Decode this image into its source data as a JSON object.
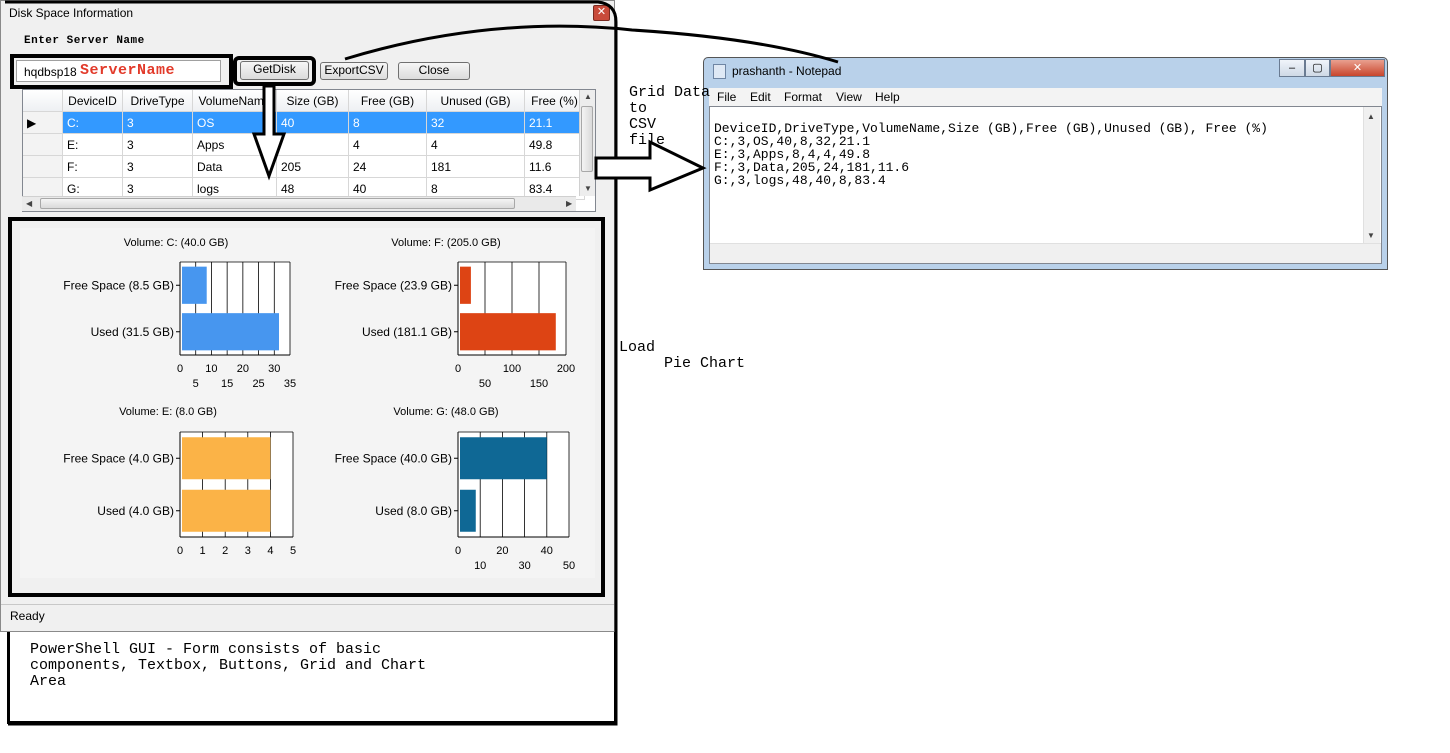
{
  "form": {
    "title": "Disk Space Information",
    "server_label": "Enter Server Name",
    "server_value": "hqdbsp18",
    "server_annotation": "ServerName",
    "buttons": {
      "getdisk": "GetDisk",
      "export": "ExportCSV",
      "close": "Close"
    },
    "status": "Ready"
  },
  "grid": {
    "columns": [
      "DeviceID",
      "DriveType",
      "VolumeName",
      "Size (GB)",
      "Free (GB)",
      "Unused (GB)",
      "Free (%)"
    ],
    "rows": [
      [
        "C:",
        "3",
        "OS",
        "40",
        "8",
        "32",
        "21.1"
      ],
      [
        "E:",
        "3",
        "Apps",
        "",
        "4",
        "4",
        "49.8"
      ],
      [
        "F:",
        "3",
        "Data",
        "205",
        "24",
        "181",
        "11.6"
      ],
      [
        "G:",
        "3",
        "logs",
        "48",
        "40",
        "8",
        "83.4"
      ]
    ],
    "selected_row": 0,
    "row_marker": "▶"
  },
  "chart_data": [
    {
      "type": "bar",
      "orientation": "horizontal",
      "title": "Volume: C: (40.0 GB)",
      "categories": [
        "Free Space (8.5 GB)",
        "Used (31.5 GB)"
      ],
      "values": [
        8.5,
        31.5
      ],
      "xlim": [
        0,
        35
      ],
      "ticks_top": [
        "0",
        "10",
        "20",
        "30"
      ],
      "ticks_bottom": [
        "5",
        "15",
        "25",
        "35"
      ],
      "color": "#4796ef",
      "grid": true
    },
    {
      "type": "bar",
      "orientation": "horizontal",
      "title": "Volume: F: (205.0 GB)",
      "categories": [
        "Free Space (23.9 GB)",
        "Used (181.1 GB)"
      ],
      "values": [
        23.9,
        181.1
      ],
      "xlim": [
        0,
        200
      ],
      "ticks_top": [
        "0",
        "100",
        "200"
      ],
      "ticks_bottom": [
        "50",
        "150"
      ],
      "color": "#dd4414",
      "grid": true
    },
    {
      "type": "bar",
      "orientation": "horizontal",
      "title": "Volume: E: (8.0 GB)",
      "categories": [
        "Free Space (4.0 GB)",
        "Used (4.0 GB)"
      ],
      "values": [
        4.0,
        4.0
      ],
      "xlim": [
        0,
        5
      ],
      "ticks_top": [
        "0",
        "1",
        "2",
        "3",
        "4",
        "5"
      ],
      "ticks_bottom": [],
      "color": "#fbb347",
      "grid": true
    },
    {
      "type": "bar",
      "orientation": "horizontal",
      "title": "Volume: G: (48.0 GB)",
      "categories": [
        "Free Space (40.0 GB)",
        "Used (8.0 GB)"
      ],
      "values": [
        40.0,
        8.0
      ],
      "xlim": [
        0,
        50
      ],
      "ticks_top": [
        "0",
        "20",
        "40"
      ],
      "ticks_bottom": [
        "10",
        "30",
        "50"
      ],
      "color": "#0f6895",
      "grid": true
    }
  ],
  "notepad": {
    "title": "prashanth - Notepad",
    "menu": [
      "File",
      "Edit",
      "Format",
      "View",
      "Help"
    ],
    "lines": [
      "DeviceID,DriveType,VolumeName,Size (GB),Free (GB),Unused (GB), Free (%)",
      "C:,3,OS,40,8,32,21.1",
      "E:,3,Apps,8,4,4,49.8",
      "F:,3,Data,205,24,181,11.6",
      "G:,3,logs,48,40,8,83.4"
    ]
  },
  "annotations": {
    "grid_to_csv": "Grid Data\nto\nCSV\nfile",
    "load_chart": "Load\n     Pie Chart",
    "caption": "PowerShell GUI - Form consists of basic\ncomponents, Textbox, Buttons, Grid and Chart\nArea"
  }
}
